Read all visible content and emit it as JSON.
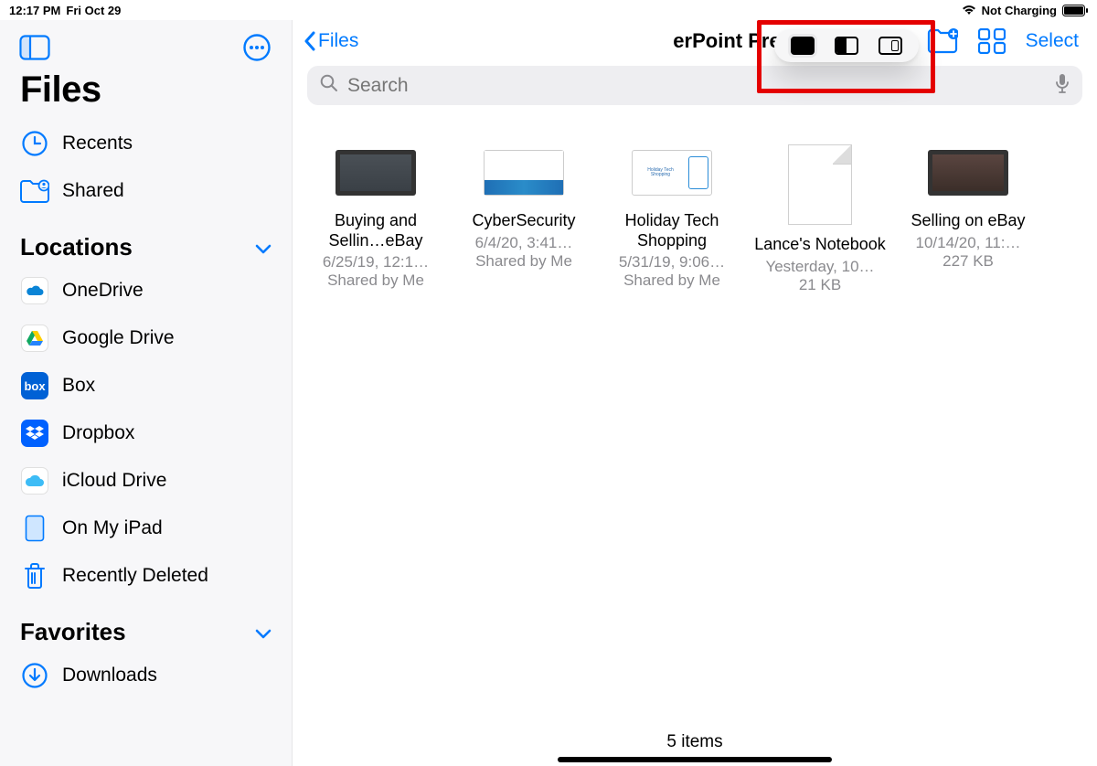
{
  "status": {
    "time": "12:17 PM",
    "date": "Fri Oct 29",
    "battery_text": "Not Charging"
  },
  "sidebar": {
    "title": "Files",
    "recents": "Recents",
    "shared": "Shared",
    "locations_header": "Locations",
    "favorites_header": "Favorites",
    "locations": [
      {
        "label": "OneDrive"
      },
      {
        "label": "Google Drive"
      },
      {
        "label": "Box"
      },
      {
        "label": "Dropbox"
      },
      {
        "label": "iCloud Drive"
      },
      {
        "label": "On My iPad"
      },
      {
        "label": "Recently Deleted"
      }
    ],
    "downloads": "Downloads"
  },
  "header": {
    "back": "Files",
    "title": "erPoint Presentations",
    "select": "Select"
  },
  "search": {
    "placeholder": "Search"
  },
  "files": [
    {
      "name": "Buying and Sellin…eBay",
      "meta": "6/25/19, 12:1…",
      "sub": "Shared by Me"
    },
    {
      "name": "CyberSecurity",
      "meta": "6/4/20, 3:41…",
      "sub": "Shared by Me"
    },
    {
      "name": "Holiday Tech Shopping",
      "meta": "5/31/19, 9:06…",
      "sub": "Shared by Me"
    },
    {
      "name": "Lance's Notebook",
      "meta": "Yesterday, 10…",
      "sub": "21 KB"
    },
    {
      "name": "Selling on eBay",
      "meta": "10/14/20, 11:…",
      "sub": "227 KB"
    }
  ],
  "footer": {
    "count": "5 items"
  },
  "colors": {
    "accent": "#007aff"
  }
}
